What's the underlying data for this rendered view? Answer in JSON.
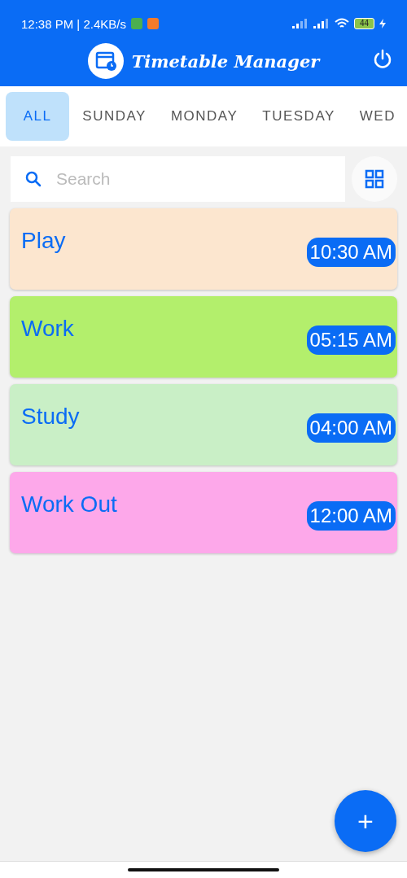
{
  "status_bar": {
    "time": "12:38 PM | 2.4KB/s",
    "battery": "44"
  },
  "app_bar": {
    "title": "Timetable Manager"
  },
  "tabs": [
    {
      "label": "ALL",
      "selected": true
    },
    {
      "label": "SUNDAY",
      "selected": false
    },
    {
      "label": "MONDAY",
      "selected": false
    },
    {
      "label": "TUESDAY",
      "selected": false
    },
    {
      "label": "WED",
      "selected": false
    }
  ],
  "search": {
    "placeholder": "Search"
  },
  "tasks": [
    {
      "title": "Play",
      "time": "10:30 AM",
      "color": "#fce6cf"
    },
    {
      "title": "Work",
      "time": "05:15 AM",
      "color": "#b3ef6c"
    },
    {
      "title": "Study",
      "time": "04:00 AM",
      "color": "#c9efc6"
    },
    {
      "title": "Work Out",
      "time": "12:00 AM",
      "color": "#fda8ea"
    }
  ],
  "fab": {
    "label": "+"
  }
}
